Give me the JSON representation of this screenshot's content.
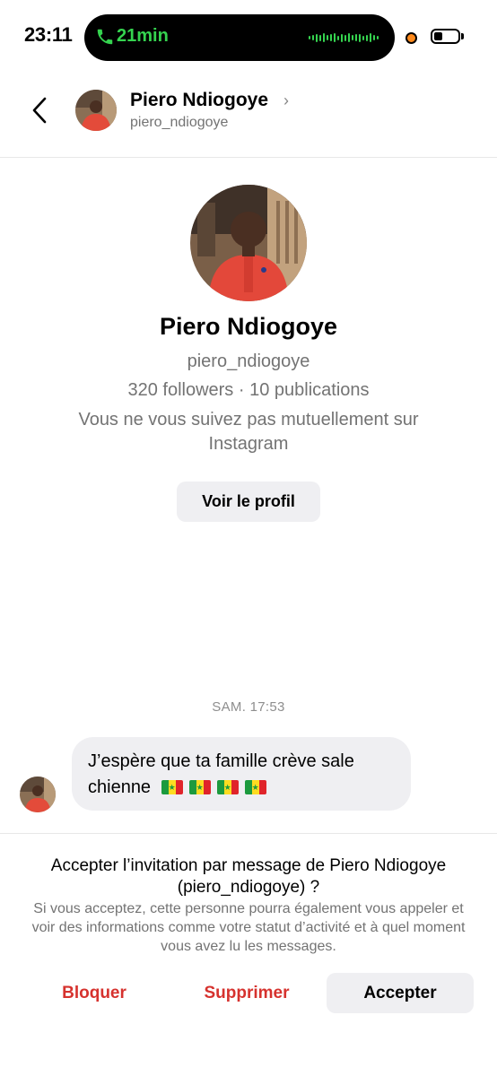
{
  "status_bar": {
    "time": "23:11",
    "call_timer": "21min"
  },
  "header": {
    "name": "Piero Ndiogoye",
    "username": "piero_ndiogoye",
    "chevron": "›"
  },
  "profile": {
    "name": "Piero Ndiogoye",
    "username": "piero_ndiogoye",
    "stats": "320 followers · 10 publications",
    "mutual": "Vous ne vous suivez pas mutuellement sur Instagram",
    "view_profile_label": "Voir le profil"
  },
  "messages": {
    "timestamp": "SAM. 17:53",
    "items": [
      {
        "text": "J’espère que ta famille crève sale chienne",
        "flags": [
          "senegal-flag",
          "senegal-flag",
          "senegal-flag",
          "senegal-flag"
        ]
      }
    ]
  },
  "request_panel": {
    "title": "Accepter l’invitation par message de Piero Ndiogoye (piero_ndiogoye) ?",
    "description": "Si vous acceptez, cette personne pourra également vous appeler et voir des informations comme votre statut d’activité et à quel moment vous avez lu les messages.",
    "block_label": "Bloquer",
    "delete_label": "Supprimer",
    "accept_label": "Accepter"
  },
  "colors": {
    "call_green": "#35d34f",
    "danger_red": "#d6322e",
    "secondary_text": "#737373",
    "button_gray": "#efeff2",
    "activity_orange": "#ff8a1c"
  }
}
